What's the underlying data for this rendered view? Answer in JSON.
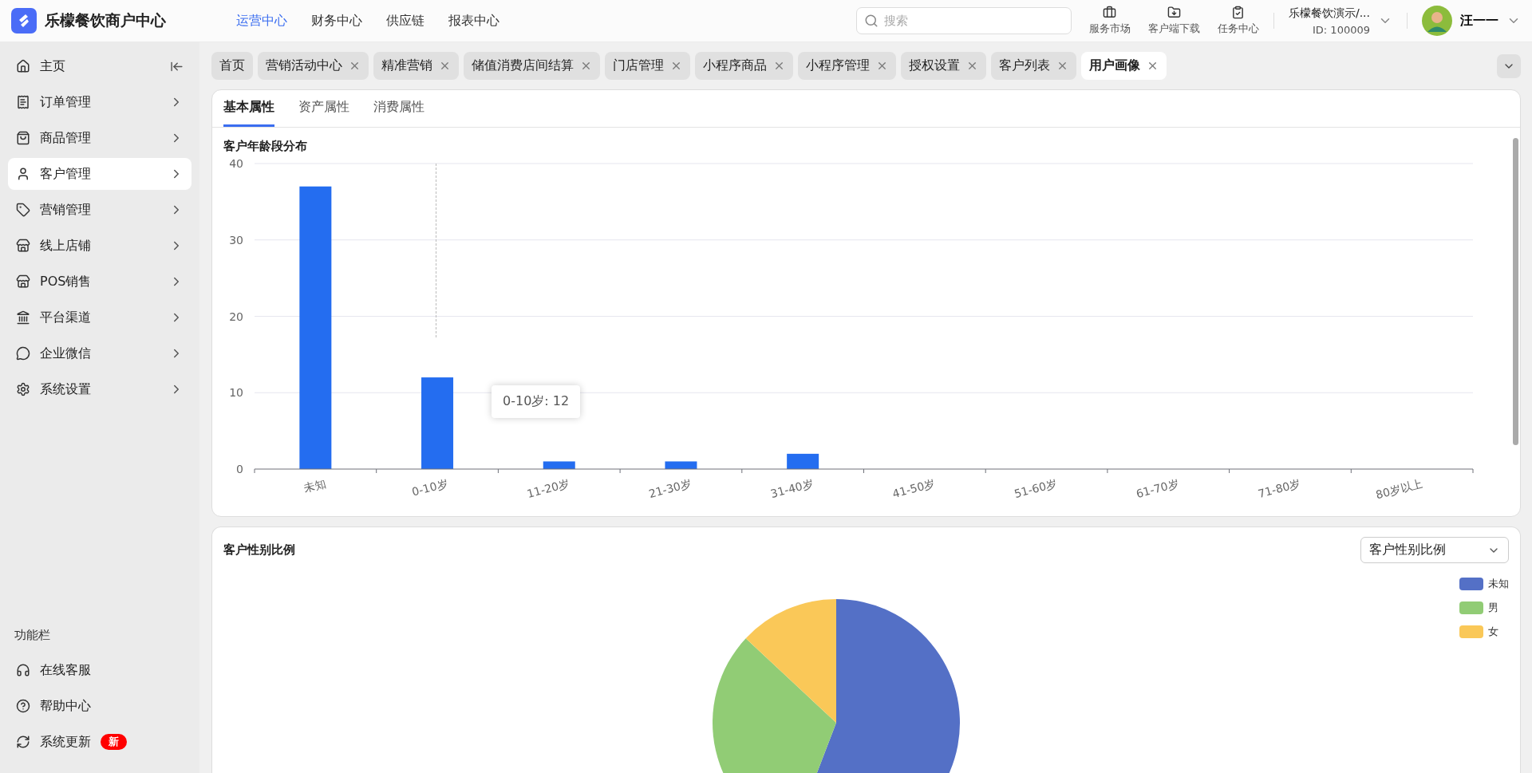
{
  "app": {
    "title": "乐檬餐饮商户中心"
  },
  "top_nav": [
    {
      "label": "运营中心",
      "selected": true
    },
    {
      "label": "财务中心",
      "selected": false
    },
    {
      "label": "供应链",
      "selected": false
    },
    {
      "label": "报表中心",
      "selected": false
    }
  ],
  "search": {
    "placeholder": "搜索"
  },
  "tools": [
    {
      "label": "服务市场"
    },
    {
      "label": "客户端下载"
    },
    {
      "label": "任务中心"
    }
  ],
  "account": {
    "store": "乐檬餐饮演示/...",
    "id": "ID: 100009",
    "user": "汪一一"
  },
  "sidebar": {
    "items": [
      {
        "label": "主页",
        "selected": false
      },
      {
        "label": "订单管理",
        "selected": false
      },
      {
        "label": "商品管理",
        "selected": false
      },
      {
        "label": "客户管理",
        "selected": true
      },
      {
        "label": "营销管理",
        "selected": false
      },
      {
        "label": "线上店铺",
        "selected": false
      },
      {
        "label": "POS销售",
        "selected": false
      },
      {
        "label": "平台渠道",
        "selected": false
      },
      {
        "label": "企业微信",
        "selected": false
      },
      {
        "label": "系统设置",
        "selected": false
      }
    ],
    "section_title": "功能栏",
    "footer_items": [
      {
        "label": "在线客服"
      },
      {
        "label": "帮助中心"
      },
      {
        "label": "系统更新",
        "badge": "新"
      }
    ]
  },
  "page_tabs": [
    {
      "label": "首页",
      "closable": false,
      "selected": false
    },
    {
      "label": "营销活动中心",
      "closable": true,
      "selected": false
    },
    {
      "label": "精准营销",
      "closable": true,
      "selected": false
    },
    {
      "label": "储值消费店间结算",
      "closable": true,
      "selected": false
    },
    {
      "label": "门店管理",
      "closable": true,
      "selected": false
    },
    {
      "label": "小程序商品",
      "closable": true,
      "selected": false
    },
    {
      "label": "小程序管理",
      "closable": true,
      "selected": false
    },
    {
      "label": "授权设置",
      "closable": true,
      "selected": false
    },
    {
      "label": "客户列表",
      "closable": true,
      "selected": false
    },
    {
      "label": "用户画像",
      "closable": true,
      "selected": true
    }
  ],
  "sub_tabs": [
    {
      "label": "基本属性",
      "selected": true
    },
    {
      "label": "资产属性",
      "selected": false
    },
    {
      "label": "消费属性",
      "selected": false
    }
  ],
  "age_chart": {
    "title": "客户年龄段分布",
    "tooltip": "0-10岁: 12",
    "chart_data": {
      "type": "bar",
      "categories": [
        "未知",
        "0-10岁",
        "11-20岁",
        "21-30岁",
        "31-40岁",
        "41-50岁",
        "51-60岁",
        "61-70岁",
        "71-80岁",
        "80岁以上"
      ],
      "grid": true,
      "series": [
        {
          "color": "#246df0",
          "values": [
            37,
            12,
            1,
            1,
            2,
            0,
            0,
            0,
            0,
            0
          ]
        }
      ],
      "ylim": [
        0,
        40
      ],
      "yticks": [
        0,
        10,
        20,
        30,
        40
      ]
    }
  },
  "gender_chart": {
    "title": "客户性别比例",
    "select": "客户性别比例",
    "legend": [
      {
        "label": "未知",
        "color": "#5470c6"
      },
      {
        "label": "男",
        "color": "#91cc75"
      },
      {
        "label": "女",
        "color": "#fac858"
      }
    ]
  }
}
